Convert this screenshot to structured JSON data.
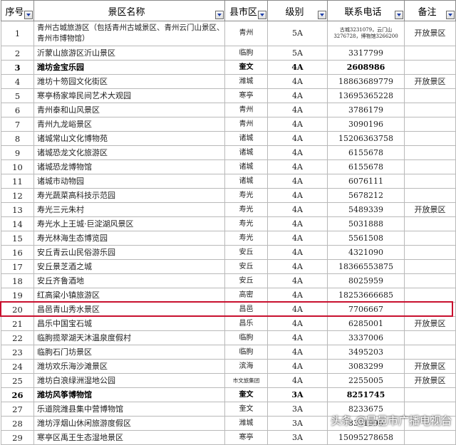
{
  "headers": [
    "序号",
    "景区名称",
    "县市区",
    "级别",
    "联系电话",
    "备注"
  ],
  "rows": [
    {
      "no": "1",
      "name": "青州古城旅游区（包括青州古城景区、青州云门山景区、青州市博物馆）",
      "city": "青州",
      "level": "5A",
      "phone": "古城3231079，云门山3276728，博物馆3266200",
      "note": "开放景区",
      "bold": false
    },
    {
      "no": "2",
      "name": "沂蒙山旅游区沂山景区",
      "city": "临朐",
      "level": "5A",
      "phone": "3317799",
      "note": "",
      "bold": false
    },
    {
      "no": "3",
      "name": "潍坊金宝乐园",
      "city": "奎文",
      "level": "4A",
      "phone": "2608986",
      "note": "",
      "bold": true
    },
    {
      "no": "4",
      "name": "潍坊十笏园文化街区",
      "city": "潍城",
      "level": "4A",
      "phone": "18863689779",
      "note": "开放景区",
      "bold": false
    },
    {
      "no": "5",
      "name": "寒亭杨家埠民间艺术大观园",
      "city": "寒亭",
      "level": "4A",
      "phone": "13695365228",
      "note": "",
      "bold": false
    },
    {
      "no": "6",
      "name": "青州泰和山风景区",
      "city": "青州",
      "level": "4A",
      "phone": "3786179",
      "note": "",
      "bold": false
    },
    {
      "no": "7",
      "name": "青州九龙峪景区",
      "city": "青州",
      "level": "4A",
      "phone": "3090196",
      "note": "",
      "bold": false
    },
    {
      "no": "8",
      "name": "诸城常山文化博物苑",
      "city": "诸城",
      "level": "4A",
      "phone": "15206363758",
      "note": "",
      "bold": false
    },
    {
      "no": "9",
      "name": "诸城恐龙文化旅游区",
      "city": "诸城",
      "level": "4A",
      "phone": "6155678",
      "note": "",
      "bold": false
    },
    {
      "no": "10",
      "name": "诸城恐龙博物馆",
      "city": "诸城",
      "level": "4A",
      "phone": "6155678",
      "note": "",
      "bold": false
    },
    {
      "no": "11",
      "name": "诸城市动物园",
      "city": "诸城",
      "level": "4A",
      "phone": "6076111",
      "note": "",
      "bold": false
    },
    {
      "no": "12",
      "name": "寿光蔬菜高科技示范园",
      "city": "寿光",
      "level": "4A",
      "phone": "5678212",
      "note": "",
      "bold": false
    },
    {
      "no": "13",
      "name": "寿光三元朱村",
      "city": "寿光",
      "level": "4A",
      "phone": "5489339",
      "note": "开放景区",
      "bold": false
    },
    {
      "no": "14",
      "name": "寿光水上王城·巨淀湖风景区",
      "city": "寿光",
      "level": "4A",
      "phone": "5031888",
      "note": "",
      "bold": false
    },
    {
      "no": "15",
      "name": "寿光林海生态博览园",
      "city": "寿光",
      "level": "4A",
      "phone": "5561508",
      "note": "",
      "bold": false
    },
    {
      "no": "16",
      "name": "安丘青云山民俗游乐园",
      "city": "安丘",
      "level": "4A",
      "phone": "4321090",
      "note": "",
      "bold": false
    },
    {
      "no": "17",
      "name": "安丘景芝酒之城",
      "city": "安丘",
      "level": "4A",
      "phone": "18366553875",
      "note": "",
      "bold": false
    },
    {
      "no": "18",
      "name": "安丘齐鲁酒地",
      "city": "安丘",
      "level": "4A",
      "phone": "8025959",
      "note": "",
      "bold": false
    },
    {
      "no": "19",
      "name": "红高粱小镇旅游区",
      "city": "高密",
      "level": "4A",
      "phone": "18253666685",
      "note": "",
      "bold": false
    },
    {
      "no": "20",
      "name": "昌邑青山秀水景区",
      "city": "昌邑",
      "level": "4A",
      "phone": "7706667",
      "note": "",
      "bold": false
    },
    {
      "no": "21",
      "name": "昌乐中国宝石城",
      "city": "昌乐",
      "level": "4A",
      "phone": "6285001",
      "note": "开放景区",
      "bold": false
    },
    {
      "no": "22",
      "name": "临朐揽翠湖天沐温泉度假村",
      "city": "临朐",
      "level": "4A",
      "phone": "3337006",
      "note": "",
      "bold": false
    },
    {
      "no": "23",
      "name": "临朐石门坊景区",
      "city": "临朐",
      "level": "4A",
      "phone": "3495203",
      "note": "",
      "bold": false
    },
    {
      "no": "24",
      "name": "潍坊欢乐海沙滩景区",
      "city": "滨海",
      "level": "4A",
      "phone": "3083299",
      "note": "开放景区",
      "bold": false
    },
    {
      "no": "25",
      "name": "潍坊白浪绿洲湿地公园",
      "city": "市文旅集团",
      "level": "4A",
      "phone": "2255005",
      "note": "开放景区",
      "bold": false
    },
    {
      "no": "26",
      "name": "潍坊风筝博物馆",
      "city": "奎文",
      "level": "3A",
      "phone": "8251745",
      "note": "",
      "bold": true
    },
    {
      "no": "27",
      "name": "乐道院潍县集中营博物馆",
      "city": "奎文",
      "level": "3A",
      "phone": "8233675",
      "note": "",
      "bold": false
    },
    {
      "no": "28",
      "name": "潍坊浮烟山休闲旅游度假区",
      "city": "潍城",
      "level": "3A",
      "phone": "8391996",
      "note": "",
      "bold": false
    },
    {
      "no": "29",
      "name": "寒亭区禹王生态湿地景区",
      "city": "寒亭",
      "level": "3A",
      "phone": "15095278658",
      "note": "",
      "bold": false
    }
  ],
  "highlight_row_no": "20",
  "watermark": "头条 @昌邑市广播电视台"
}
